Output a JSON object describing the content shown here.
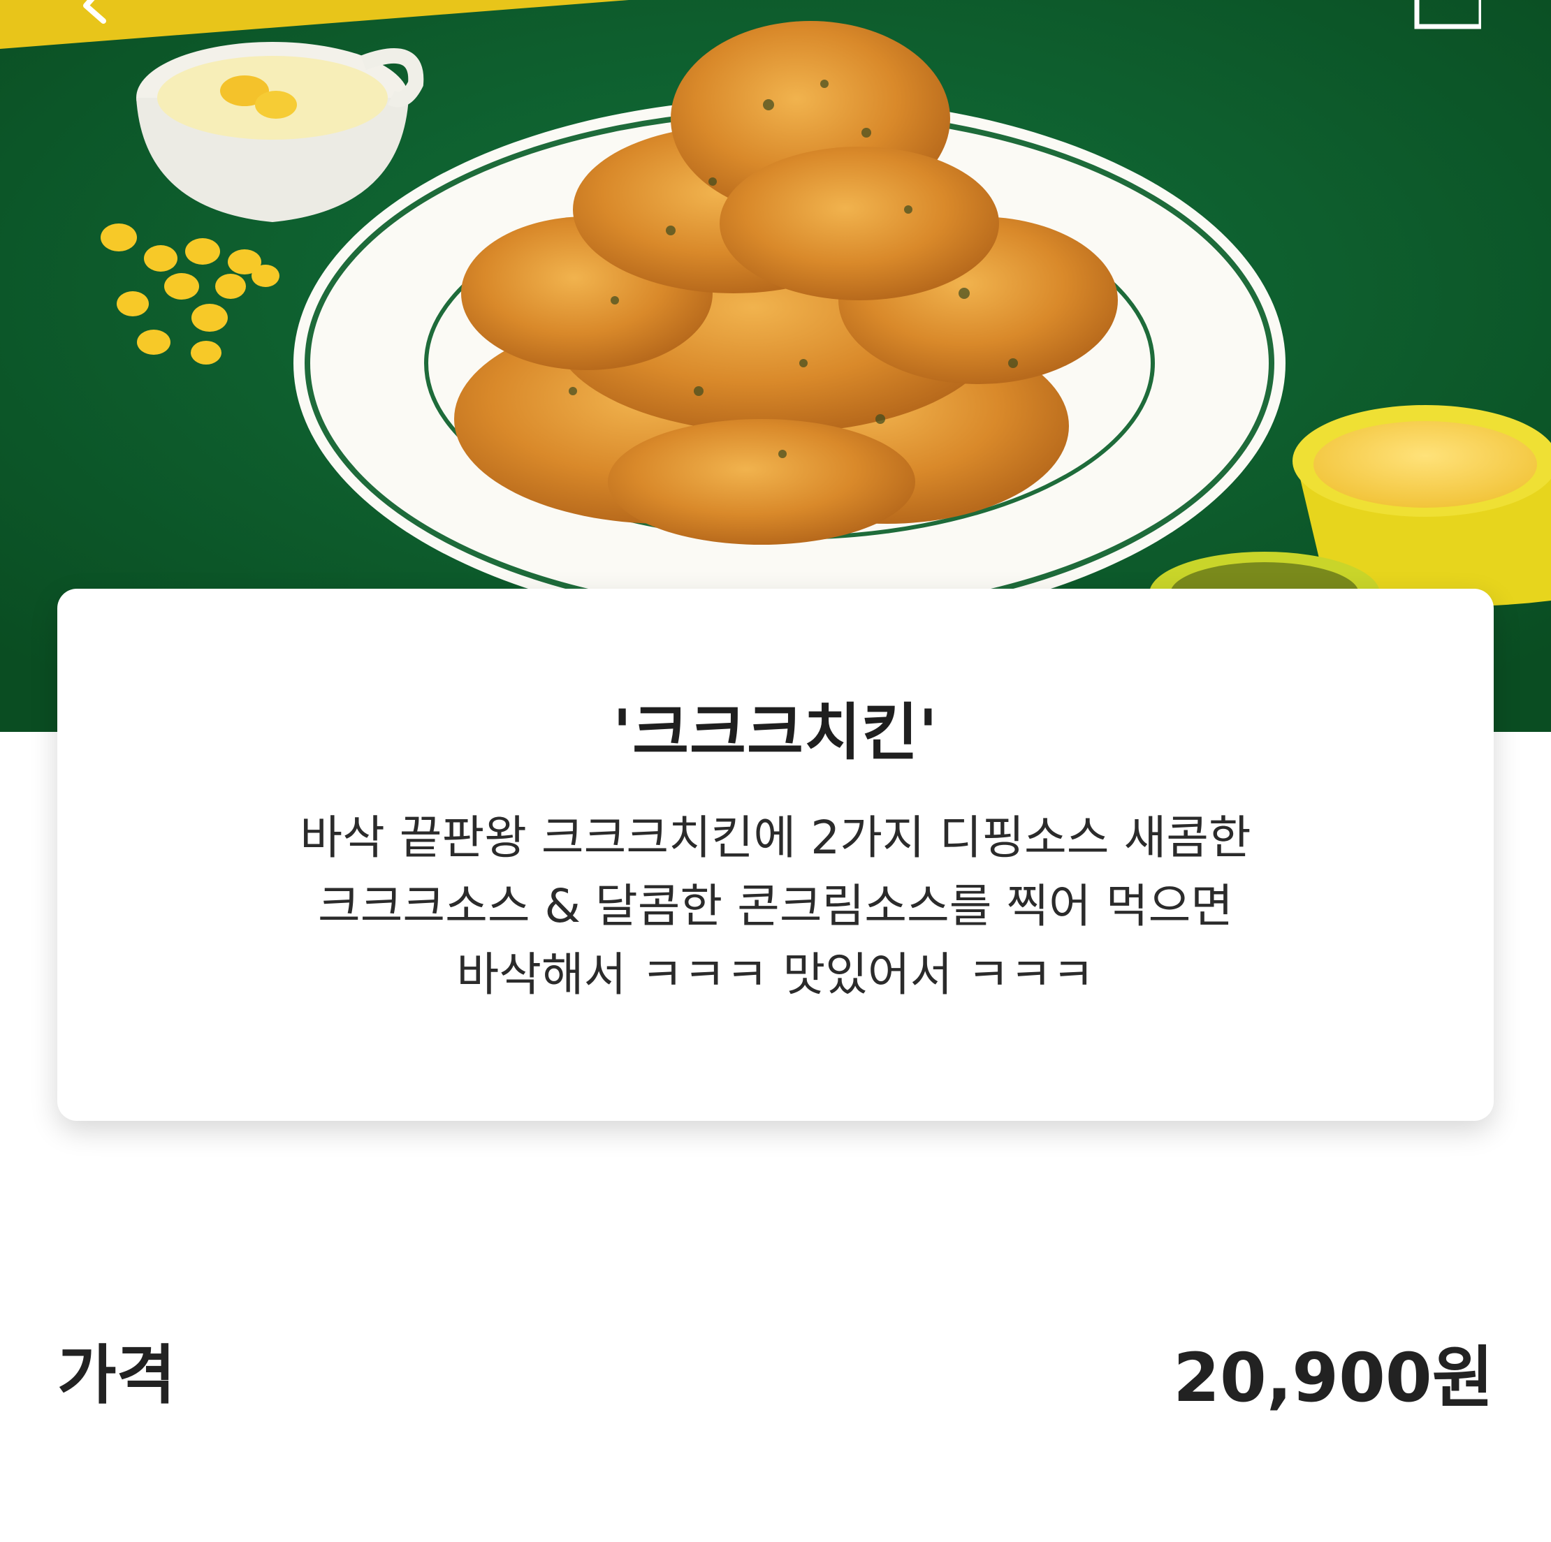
{
  "header": {
    "back_icon": "chevron-left-icon",
    "share_icon": "share-box-icon",
    "accent_color": "#e8c51a"
  },
  "hero": {
    "background_color": "#0d5b2a",
    "image_alt": "fried chicken on a plate with corn and dipping sauces"
  },
  "menu": {
    "title": "'크크크치킨'",
    "description_lines": [
      "바삭 끝판왕 크크크치킨에 2가지 디핑소스 새콤한",
      "크크크소스 & 달콤한 콘크림소스를 찍어 먹으면",
      "바삭해서 ㅋㅋㅋ 맛있어서 ㅋㅋㅋ"
    ]
  },
  "price": {
    "label": "가격",
    "value": "20,900원"
  }
}
